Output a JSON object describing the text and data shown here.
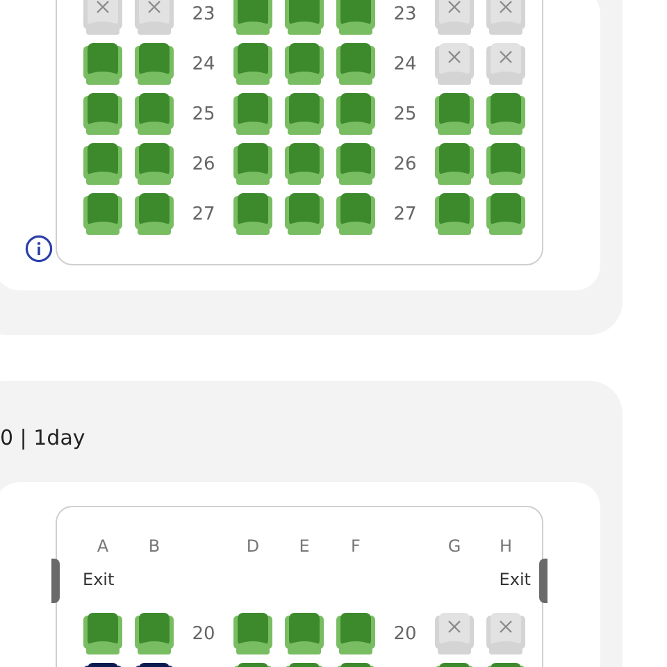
{
  "sections": [
    {
      "seat_map": {
        "rows": [
          {
            "labels": [
              "23",
              "23"
            ],
            "seats": [
              {
                "available": false,
                "selected": false
              },
              {
                "available": false,
                "selected": false
              },
              {
                "available": true,
                "selected": false
              },
              {
                "available": true,
                "selected": false
              },
              {
                "available": true,
                "selected": false
              },
              {
                "available": false,
                "selected": false
              },
              {
                "available": false,
                "selected": false
              }
            ]
          },
          {
            "labels": [
              "24",
              "24"
            ],
            "seats": [
              {
                "available": true,
                "selected": false
              },
              {
                "available": true,
                "selected": false
              },
              {
                "available": true,
                "selected": false
              },
              {
                "available": true,
                "selected": false
              },
              {
                "available": true,
                "selected": false
              },
              {
                "available": false,
                "selected": false
              },
              {
                "available": false,
                "selected": false
              }
            ]
          },
          {
            "labels": [
              "25",
              "25"
            ],
            "seats": [
              {
                "available": true,
                "selected": false
              },
              {
                "available": true,
                "selected": false
              },
              {
                "available": true,
                "selected": false
              },
              {
                "available": true,
                "selected": false
              },
              {
                "available": true,
                "selected": false
              },
              {
                "available": true,
                "selected": false
              },
              {
                "available": true,
                "selected": false
              }
            ]
          },
          {
            "labels": [
              "26",
              "26"
            ],
            "seats": [
              {
                "available": true,
                "selected": false
              },
              {
                "available": true,
                "selected": false
              },
              {
                "available": true,
                "selected": false
              },
              {
                "available": true,
                "selected": false
              },
              {
                "available": true,
                "selected": false
              },
              {
                "available": true,
                "selected": false
              },
              {
                "available": true,
                "selected": false
              }
            ]
          },
          {
            "labels": [
              "27",
              "27"
            ],
            "seats": [
              {
                "available": true,
                "selected": false
              },
              {
                "available": true,
                "selected": false
              },
              {
                "available": true,
                "selected": false
              },
              {
                "available": true,
                "selected": false
              },
              {
                "available": true,
                "selected": false
              },
              {
                "available": true,
                "selected": false
              },
              {
                "available": true,
                "selected": false
              }
            ]
          }
        ]
      },
      "info_icon": true
    },
    {
      "title": "0 | 1day",
      "seat_map": {
        "columns": [
          "A",
          "B",
          "D",
          "E",
          "F",
          "G",
          "H"
        ],
        "exits": [
          "Exit",
          "Exit"
        ],
        "rows": [
          {
            "labels": [
              "20",
              "20"
            ],
            "seats": [
              {
                "available": true,
                "selected": false
              },
              {
                "available": true,
                "selected": false
              },
              {
                "available": true,
                "selected": false
              },
              {
                "available": true,
                "selected": false
              },
              {
                "available": true,
                "selected": false
              },
              {
                "available": false,
                "selected": false
              },
              {
                "available": false,
                "selected": false
              }
            ]
          },
          {
            "seats": [
              {
                "available": true,
                "selected": true
              },
              {
                "available": true,
                "selected": true
              },
              {
                "available": true,
                "selected": false
              },
              {
                "available": true,
                "selected": false
              },
              {
                "available": true,
                "selected": false
              },
              {
                "available": true,
                "selected": false
              },
              {
                "available": true,
                "selected": false
              }
            ]
          }
        ]
      }
    }
  ]
}
